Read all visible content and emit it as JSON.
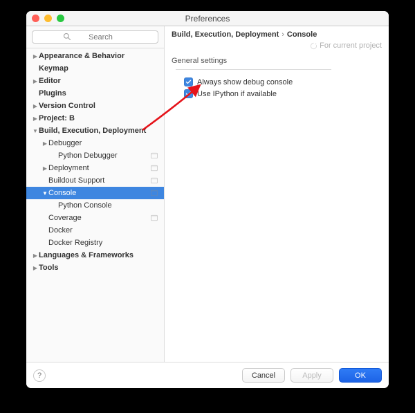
{
  "window": {
    "title": "Preferences"
  },
  "search": {
    "placeholder": "Search"
  },
  "breadcrumb": {
    "parent": "Build, Execution, Deployment",
    "current": "Console",
    "project_scope_label": "For current project"
  },
  "section": {
    "title": "General settings"
  },
  "settings": {
    "always_show_debug_console": {
      "label": "Always show debug console",
      "checked": true
    },
    "use_ipython": {
      "label": "Use IPython if available",
      "checked": true
    }
  },
  "buttons": {
    "help_tooltip": "?",
    "cancel": "Cancel",
    "apply": "Apply",
    "ok": "OK"
  },
  "tree": [
    {
      "label": "Appearance & Behavior",
      "depth": 0,
      "bold": true,
      "expand": "closed"
    },
    {
      "label": "Keymap",
      "depth": 0,
      "bold": true,
      "expand": "none"
    },
    {
      "label": "Editor",
      "depth": 0,
      "bold": true,
      "expand": "closed"
    },
    {
      "label": "Plugins",
      "depth": 0,
      "bold": true,
      "expand": "none"
    },
    {
      "label": "Version Control",
      "depth": 0,
      "bold": true,
      "expand": "closed"
    },
    {
      "label": "Project: B",
      "depth": 0,
      "bold": true,
      "expand": "closed"
    },
    {
      "label": "Build, Execution, Deployment",
      "depth": 0,
      "bold": true,
      "expand": "open"
    },
    {
      "label": "Debugger",
      "depth": 1,
      "bold": false,
      "expand": "closed"
    },
    {
      "label": "Python Debugger",
      "depth": 2,
      "bold": false,
      "expand": "none",
      "badge": true
    },
    {
      "label": "Deployment",
      "depth": 1,
      "bold": false,
      "expand": "closed",
      "badge": true
    },
    {
      "label": "Buildout Support",
      "depth": 1,
      "bold": false,
      "expand": "none",
      "badge": true
    },
    {
      "label": "Console",
      "depth": 1,
      "bold": false,
      "expand": "open",
      "badge": true,
      "selected": true
    },
    {
      "label": "Python Console",
      "depth": 2,
      "bold": false,
      "expand": "none"
    },
    {
      "label": "Coverage",
      "depth": 1,
      "bold": false,
      "expand": "none",
      "badge": true
    },
    {
      "label": "Docker",
      "depth": 1,
      "bold": false,
      "expand": "none"
    },
    {
      "label": "Docker Registry",
      "depth": 1,
      "bold": false,
      "expand": "none"
    },
    {
      "label": "Languages & Frameworks",
      "depth": 0,
      "bold": true,
      "expand": "closed"
    },
    {
      "label": "Tools",
      "depth": 0,
      "bold": true,
      "expand": "closed"
    }
  ]
}
